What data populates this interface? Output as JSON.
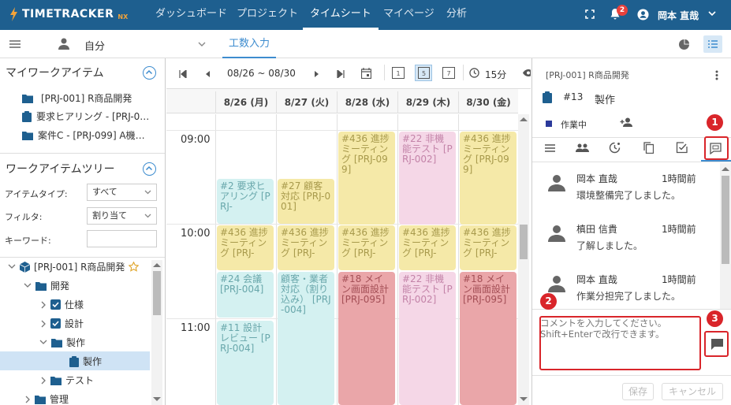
{
  "app": {
    "logo_text": "TIMETRACKER",
    "logo_suffix": "NX"
  },
  "nav": {
    "items": [
      {
        "label": "ダッシュボード",
        "active": false
      },
      {
        "label": "プロジェクト",
        "active": false
      },
      {
        "label": "タイムシート",
        "active": true
      },
      {
        "label": "マイページ",
        "active": false
      },
      {
        "label": "分析",
        "active": false
      }
    ]
  },
  "header": {
    "notification_count": "2",
    "user_name": "岡本 直哉"
  },
  "subbar": {
    "user_select": "自分",
    "tab_label": "工数入力"
  },
  "my_work_items": {
    "title": "マイワークアイテム",
    "items": [
      {
        "label": "[PRJ-001] R商品開発",
        "icon": "folder-icon"
      },
      {
        "label": "要求ヒアリング - [PRJ-0…",
        "icon": "clipboard-icon"
      },
      {
        "label": "案件C - [PRJ-099] A機…",
        "icon": "folder-icon"
      }
    ]
  },
  "work_item_tree": {
    "title": "ワークアイテムツリー",
    "filters": [
      {
        "label": "アイテムタイプ:",
        "value": "すべて"
      },
      {
        "label": "フィルタ:",
        "value": "割り当て"
      },
      {
        "label": "キーワード:",
        "value": ""
      }
    ],
    "nodes": [
      {
        "label": "[PRJ-001] R商品開発",
        "icon": "cube-icon",
        "toggle": "chevron-down-icon"
      },
      {
        "label": "開発",
        "icon": "folder-icon",
        "toggle": "chevron-down-icon"
      },
      {
        "label": "仕様",
        "icon": "checkbox-icon",
        "toggle": "chevron-right-icon"
      },
      {
        "label": "設計",
        "icon": "checkbox-icon",
        "toggle": "chevron-right-icon"
      },
      {
        "label": "製作",
        "icon": "folder-icon",
        "toggle": "chevron-down-icon"
      },
      {
        "label": "製作",
        "icon": "clipboard-icon",
        "toggle": "",
        "selected": true
      },
      {
        "label": "テスト",
        "icon": "folder-icon",
        "toggle": "chevron-right-icon"
      },
      {
        "label": "管理",
        "icon": "folder-icon",
        "toggle": "chevron-right-icon"
      }
    ]
  },
  "timesheet": {
    "date_range": "08/26 ~ 08/30",
    "interval": "15分",
    "day_view_icon": "1",
    "week_view_icon": "5",
    "seven_day_icon": "7",
    "days": [
      "8/26 (月)",
      "8/27 (火)",
      "8/28 (水)",
      "8/29 (木)",
      "8/30 (金)"
    ],
    "times": [
      "09:00",
      "10:00",
      "11:00"
    ],
    "events": [
      {
        "text": "#436 進捗ミーティング [PRJ-099]",
        "color": "yel"
      },
      {
        "text": "#22 非機能テスト [PRJ-002]",
        "color": "pink"
      },
      {
        "text": "#436 進捗ミーティング [PRJ-099]",
        "color": "yel"
      },
      {
        "text": "#2 要求ヒアリング [PRJ-",
        "color": "cyan"
      },
      {
        "text": "#27 顧客対応 [PRJ-001]",
        "color": "yel"
      },
      {
        "text": "#436 進捗ミーティング [PRJ-",
        "color": "yel"
      },
      {
        "text": "#436 進捗ミーティング [PRJ-",
        "color": "yel"
      },
      {
        "text": "#436 進捗ミーティング [PRJ-",
        "color": "yel"
      },
      {
        "text": "#436 進捗ミーティング [PRJ-",
        "color": "yel"
      },
      {
        "text": "#436 進捗ミーティング [PRJ-",
        "color": "yel"
      },
      {
        "text": "#24 会議 [PRJ-004]",
        "color": "cyan"
      },
      {
        "text": "顧客・業者対応（割り込み） [PRJ-004]",
        "color": "cyan"
      },
      {
        "text": "#18 メイン画面設計 [PRJ-095]",
        "color": "red"
      },
      {
        "text": "#22 非機能テスト [PRJ-002]",
        "color": "pink"
      },
      {
        "text": "#18 メイン画面設計 [PRJ-095]",
        "color": "red"
      },
      {
        "text": "#11 設計レビュー [PRJ-004]",
        "color": "cyan"
      }
    ]
  },
  "detail": {
    "breadcrumb": "[PRJ-001] R商品開発",
    "item_number": "#13",
    "item_name": "製作",
    "status": "作業中",
    "comments": [
      {
        "name": "岡本 直哉",
        "time": "1時間前",
        "text": "環境整備完了しました。"
      },
      {
        "name": "槙田 信貴",
        "time": "1時間前",
        "text": "了解しました。"
      },
      {
        "name": "岡本 直哉",
        "time": "1時間前",
        "text": "作業分担完了しました。"
      }
    ],
    "comment_placeholder": "コメントを入力してください。\nShift+Enterで改行できます。",
    "save_label": "保存",
    "cancel_label": "キャンセル"
  },
  "markers": [
    "1",
    "2",
    "3"
  ],
  "colors": {
    "header_bg": "#1e5f8f",
    "accent": "#3d8ccf",
    "marker_red": "#d9252a"
  }
}
